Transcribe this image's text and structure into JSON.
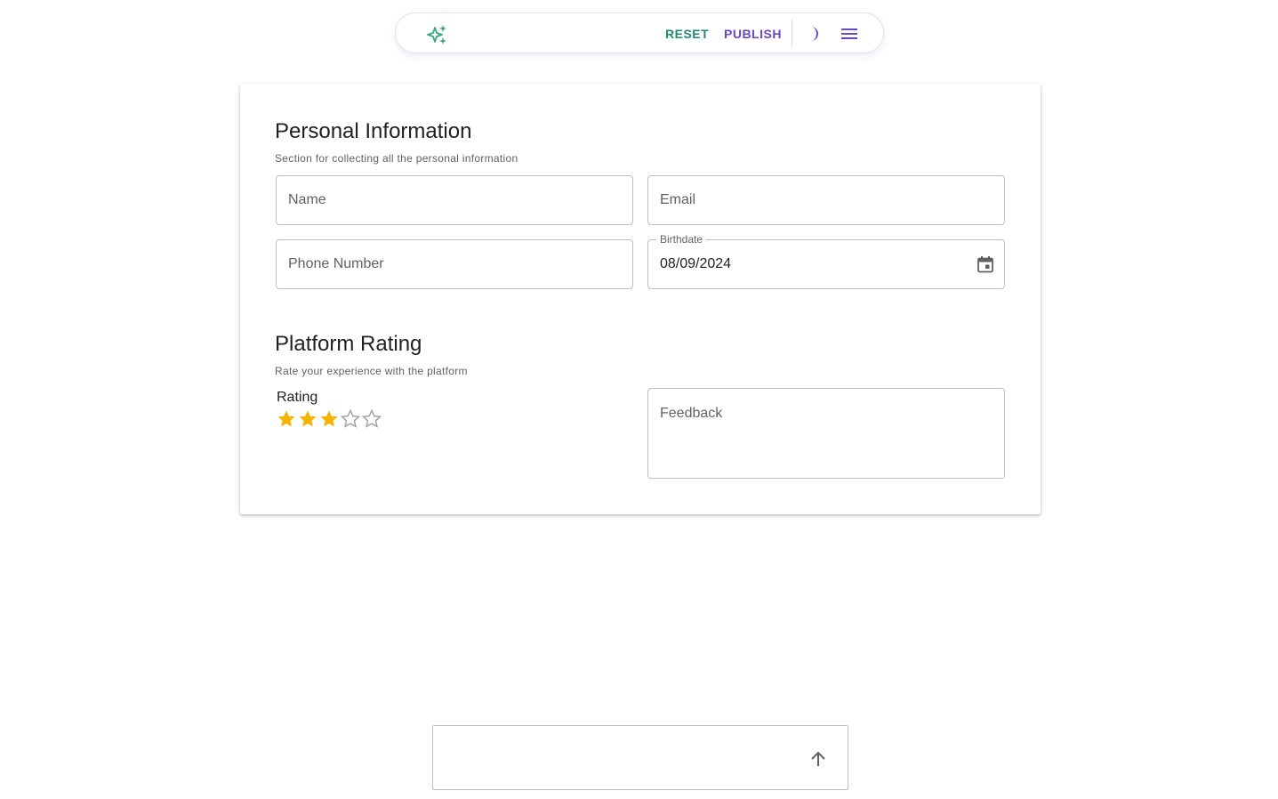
{
  "toolbar": {
    "reset_label": "RESET",
    "publish_label": "PUBLISH",
    "icons": [
      "sparkle-icon",
      "moon-icon",
      "menu-icon"
    ],
    "colors": {
      "reset": "#1e8c6e",
      "publish": "#6a45c9"
    }
  },
  "personal_section": {
    "title": "Personal Information",
    "subtitle": "Section for collecting all the personal information",
    "name_placeholder": "Name",
    "email_placeholder": "Email",
    "phone_placeholder": "Phone Number",
    "birthdate_label": "Birthdate",
    "birthdate_value": "08/09/2024"
  },
  "rating_section": {
    "title": "Platform Rating",
    "subtitle": "Rate your experience with the platform",
    "rating_label": "Rating",
    "rating_value": 3,
    "rating_max": 5,
    "feedback_placeholder": "Feedback",
    "star_color": "#f5b400"
  },
  "chat": {
    "input_value": ""
  }
}
